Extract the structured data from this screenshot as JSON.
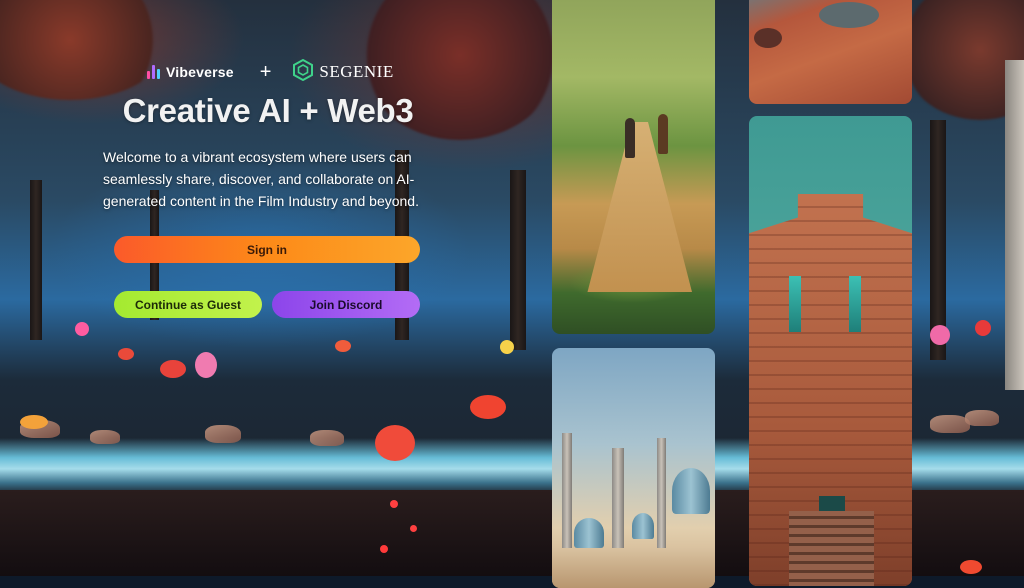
{
  "header": {
    "brand_left": "Vibeverse",
    "separator": "+",
    "brand_right": "SEGENIE"
  },
  "hero": {
    "title": "Creative AI + Web3",
    "subtitle": "Welcome to a vibrant ecosystem where users can seamlessly share, discover, and collaborate on AI-generated content in the Film Industry and beyond."
  },
  "actions": {
    "sign_in": "Sign in",
    "guest": "Continue as Guest",
    "discord": "Join Discord"
  },
  "icons": {
    "vibeverse_logo": "vibeverse-logo-icon",
    "segenie_logo": "segenie-hexagon-icon"
  },
  "colors": {
    "sign_in_gradient": [
      "#fb5a2a",
      "#fca62a"
    ],
    "guest_gradient": [
      "#a4ea30",
      "#c2f24c"
    ],
    "discord_gradient": [
      "#8c45ea",
      "#b36cf5"
    ],
    "segenie_accent": "#3fd28a"
  },
  "gallery": {
    "tiles": [
      "road-travelers-artwork",
      "red-rock-artwork",
      "domed-city-artwork",
      "stone-temple-artwork"
    ]
  }
}
